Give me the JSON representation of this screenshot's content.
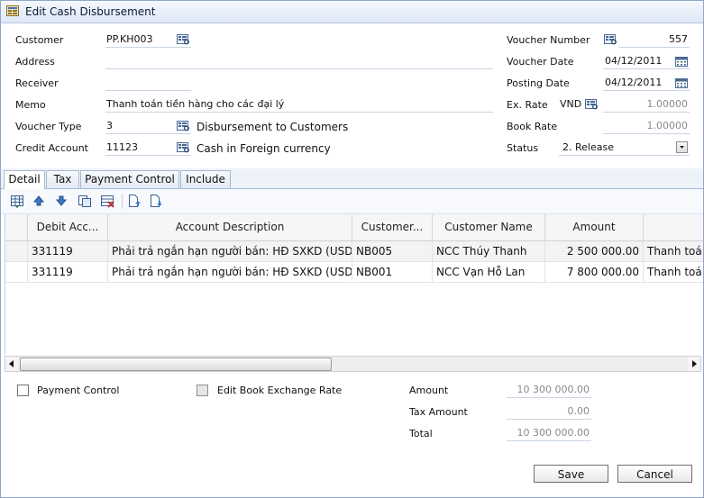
{
  "window": {
    "title": "Edit Cash Disbursement"
  },
  "form": {
    "customer": {
      "label": "Customer",
      "value": "PP.KH003"
    },
    "address": {
      "label": "Address",
      "value": ""
    },
    "receiver": {
      "label": "Receiver",
      "value": ""
    },
    "memo": {
      "label": "Memo",
      "value": "Thanh toán tiền hàng cho các đại lý"
    },
    "voucher_type": {
      "label": "Voucher Type",
      "value": "3",
      "description": "Disbursement to Customers"
    },
    "credit_account": {
      "label": "Credit Account",
      "value": "11123",
      "description": "Cash in Foreign currency"
    },
    "voucher_number": {
      "label": "Voucher Number",
      "value": "557"
    },
    "voucher_date": {
      "label": "Voucher Date",
      "value": "04/12/2011"
    },
    "posting_date": {
      "label": "Posting Date",
      "value": "04/12/2011"
    },
    "ex_rate": {
      "label": "Ex. Rate",
      "currency": "VND",
      "value": "1.00000"
    },
    "book_rate": {
      "label": "Book Rate",
      "value": "1.00000"
    },
    "status": {
      "label": "Status",
      "value": "2. Release"
    }
  },
  "tabs": [
    "Detail",
    "Tax",
    "Payment Control",
    "Include"
  ],
  "toolbar": {
    "icons": [
      "insert-row-icon",
      "move-up-icon",
      "move-down-icon",
      "copy-row-icon",
      "delete-row-icon",
      "import-icon",
      "export-icon"
    ]
  },
  "grid": {
    "columns": [
      "Debit Acc...",
      "Account Description",
      "Customer...",
      "Customer Name",
      "Amount",
      ""
    ],
    "rows": [
      [
        "331119",
        "Phải trả ngắn hạn người bán: HĐ SXKD (USD)",
        "NB005",
        "NCC Thúy Thanh",
        "2 500 000.00",
        "Thanh toá"
      ],
      [
        "331119",
        "Phải trả ngắn hạn người bán: HĐ SXKD (USD)",
        "NB001",
        "NCC Vạn Hỗ Lan",
        "7 800 000.00",
        "Thanh toá"
      ]
    ]
  },
  "footer": {
    "payment_control": {
      "label": "Payment Control",
      "checked": false
    },
    "edit_book_rate": {
      "label": "Edit Book Exchange Rate",
      "checked": false
    },
    "amount": {
      "label": "Amount",
      "value": "10 300 000.00"
    },
    "tax_amount": {
      "label": "Tax Amount",
      "value": "0.00"
    },
    "total": {
      "label": "Total",
      "value": "10 300 000.00"
    }
  },
  "buttons": {
    "save": "Save",
    "cancel": "Cancel"
  },
  "colors": {
    "title_bg": "#dfe8f5",
    "border": "#8fa6c6",
    "grid_row_alt": "#f3f3f3"
  }
}
